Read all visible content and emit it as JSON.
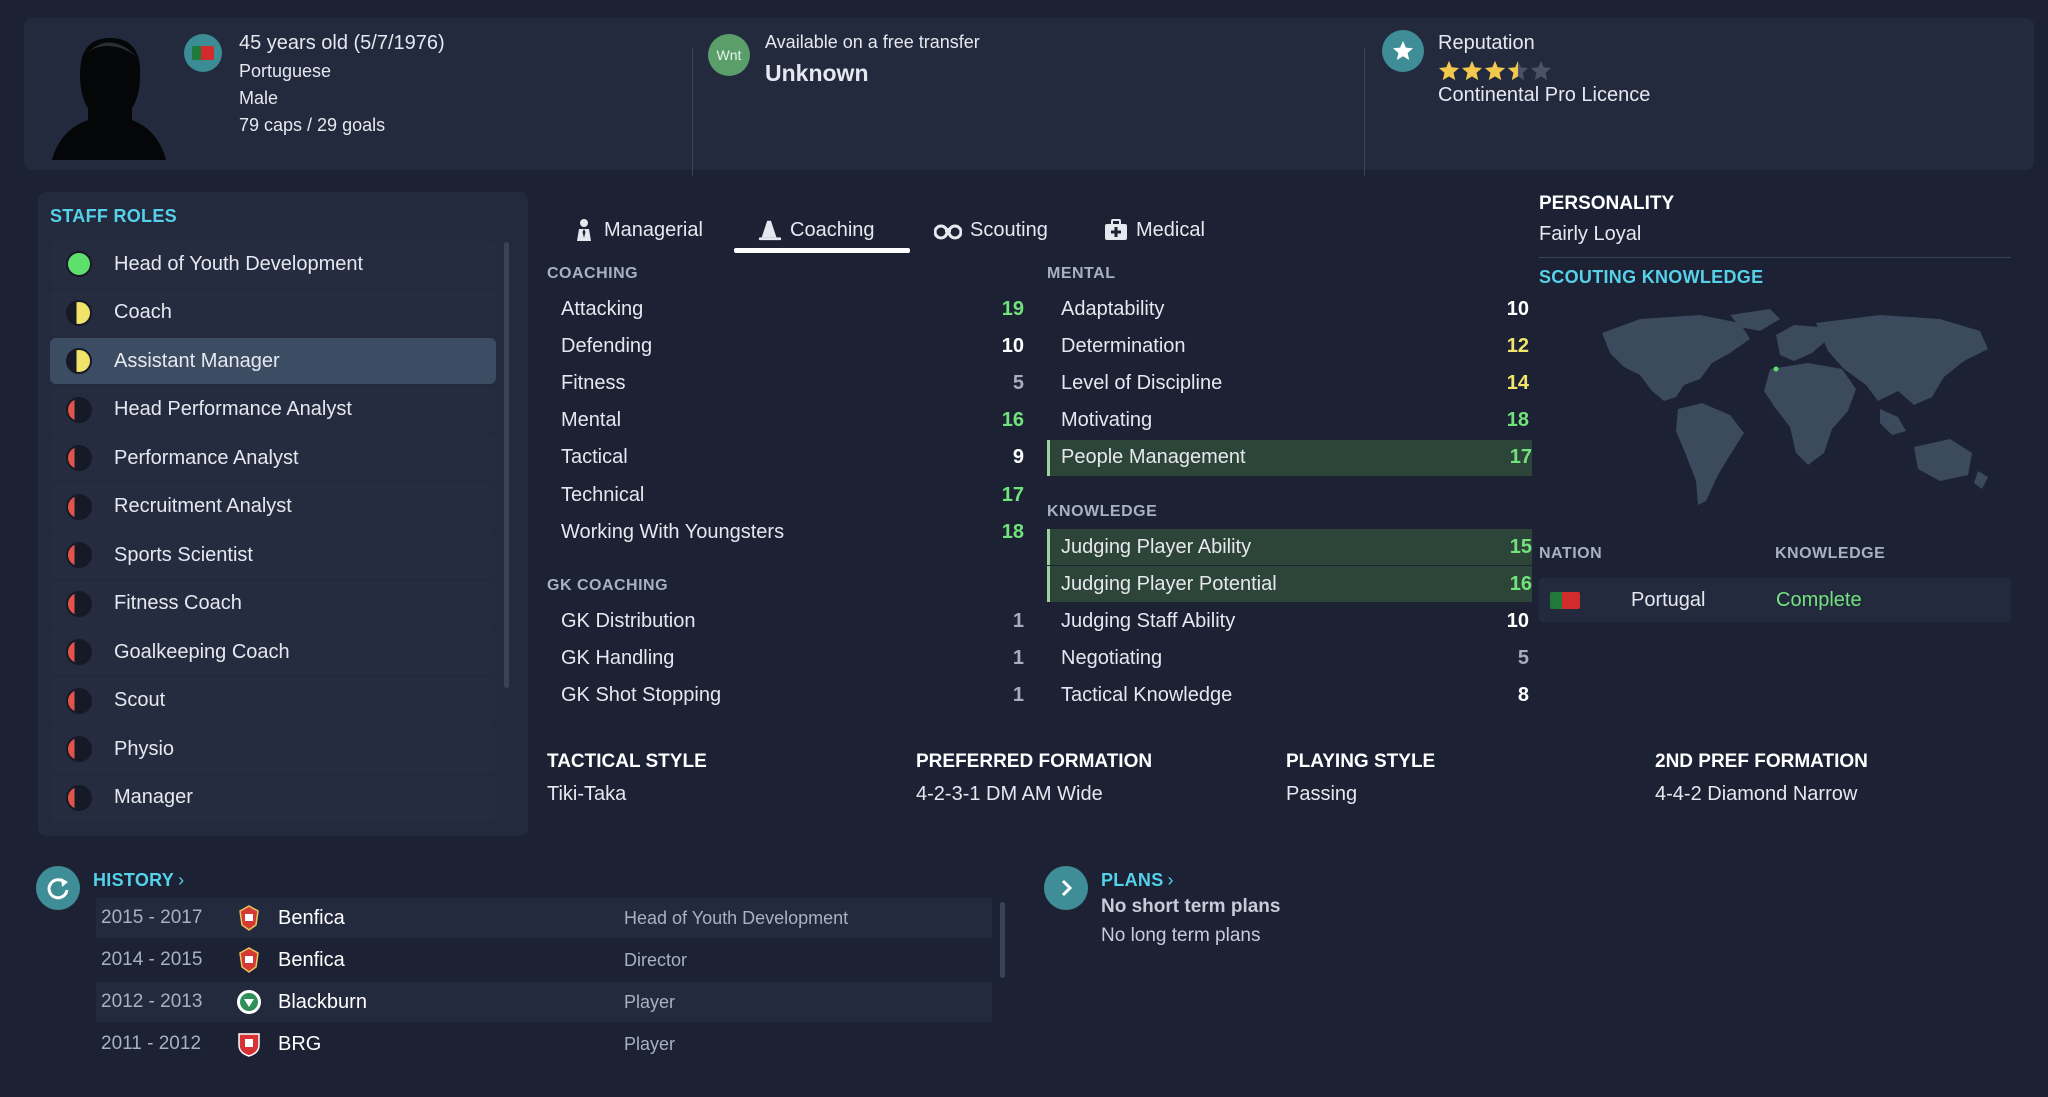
{
  "profile": {
    "age_dob": "45 years old (5/7/1976)",
    "nationality": "Portuguese",
    "gender": "Male",
    "caps": "79 caps / 29 goals",
    "wnt_badge": "Wnt",
    "transfer_status": "Available on a free transfer",
    "transfer_value": "Unknown",
    "reputation_label": "Reputation",
    "reputation_stars": 3.5,
    "reputation_max": 5,
    "licence": "Continental Pro Licence"
  },
  "staff_roles": {
    "title": "STAFF ROLES",
    "items": [
      {
        "label": "Head of Youth Development",
        "status": "green"
      },
      {
        "label": "Coach",
        "status": "half"
      },
      {
        "label": "Assistant Manager",
        "status": "half"
      },
      {
        "label": "Head Performance Analyst",
        "status": "red"
      },
      {
        "label": "Performance Analyst",
        "status": "red"
      },
      {
        "label": "Recruitment Analyst",
        "status": "red"
      },
      {
        "label": "Sports Scientist",
        "status": "red"
      },
      {
        "label": "Fitness Coach",
        "status": "red"
      },
      {
        "label": "Goalkeeping Coach",
        "status": "red"
      },
      {
        "label": "Scout",
        "status": "red"
      },
      {
        "label": "Physio",
        "status": "red"
      },
      {
        "label": "Manager",
        "status": "red"
      }
    ]
  },
  "tabs": [
    "Managerial",
    "Coaching",
    "Scouting",
    "Medical"
  ],
  "active_tab": "Coaching",
  "coaching": {
    "title": "COACHING",
    "items": [
      {
        "name": "Attacking",
        "value": "19"
      },
      {
        "name": "Defending",
        "value": "10"
      },
      {
        "name": "Fitness",
        "value": "5"
      },
      {
        "name": "Mental",
        "value": "16"
      },
      {
        "name": "Tactical",
        "value": "9"
      },
      {
        "name": "Technical",
        "value": "17"
      },
      {
        "name": "Working With Youngsters",
        "value": "18"
      }
    ]
  },
  "gk_coaching": {
    "title": "GK COACHING",
    "items": [
      {
        "name": "GK Distribution",
        "value": "1"
      },
      {
        "name": "GK Handling",
        "value": "1"
      },
      {
        "name": "GK Shot Stopping",
        "value": "1"
      }
    ]
  },
  "mental": {
    "title": "MENTAL",
    "items": [
      {
        "name": "Adaptability",
        "value": "10"
      },
      {
        "name": "Determination",
        "value": "12"
      },
      {
        "name": "Level of Discipline",
        "value": "14"
      },
      {
        "name": "Motivating",
        "value": "18"
      },
      {
        "name": "People Management",
        "value": "17"
      }
    ]
  },
  "knowledge": {
    "title": "KNOWLEDGE",
    "items": [
      {
        "name": "Judging Player Ability",
        "value": "15"
      },
      {
        "name": "Judging Player Potential",
        "value": "16"
      },
      {
        "name": "Judging Staff Ability",
        "value": "10"
      },
      {
        "name": "Negotiating",
        "value": "5"
      },
      {
        "name": "Tactical Knowledge",
        "value": "8"
      }
    ]
  },
  "bottom_info": [
    {
      "header": "TACTICAL STYLE",
      "value": "Tiki-Taka"
    },
    {
      "header": "PREFERRED FORMATION",
      "value": "4-2-3-1 DM AM Wide"
    },
    {
      "header": "PLAYING STYLE",
      "value": "Passing"
    },
    {
      "header": "2ND PREF FORMATION",
      "value": "4-4-2 Diamond Narrow"
    }
  ],
  "personality": {
    "title": "PERSONALITY",
    "value": "Fairly Loyal"
  },
  "scouting_knowledge": {
    "title": "SCOUTING KNOWLEDGE",
    "col_nation": "NATION",
    "col_knowledge": "KNOWLEDGE",
    "rows": [
      {
        "nation": "Portugal",
        "knowledge": "Complete"
      }
    ]
  },
  "history": {
    "title": "HISTORY",
    "rows": [
      {
        "years": "2015 - 2017",
        "club": "Benfica",
        "role": "Head of Youth Development"
      },
      {
        "years": "2014 - 2015",
        "club": "Benfica",
        "role": "Director"
      },
      {
        "years": "2012 - 2013",
        "club": "Blackburn",
        "role": "Player"
      },
      {
        "years": "2011 - 2012",
        "club": "BRG",
        "role": "Player"
      }
    ]
  },
  "plans": {
    "title": "PLANS",
    "short_term": "No short term plans",
    "long_term": "No long term plans"
  },
  "colors": {
    "background": "#1c2134",
    "panel": "#232a3e",
    "accent": "#55d1ea",
    "value_green": "#72e27c",
    "value_yellow": "#f3e46a",
    "highlight_row": "#2d4438"
  }
}
